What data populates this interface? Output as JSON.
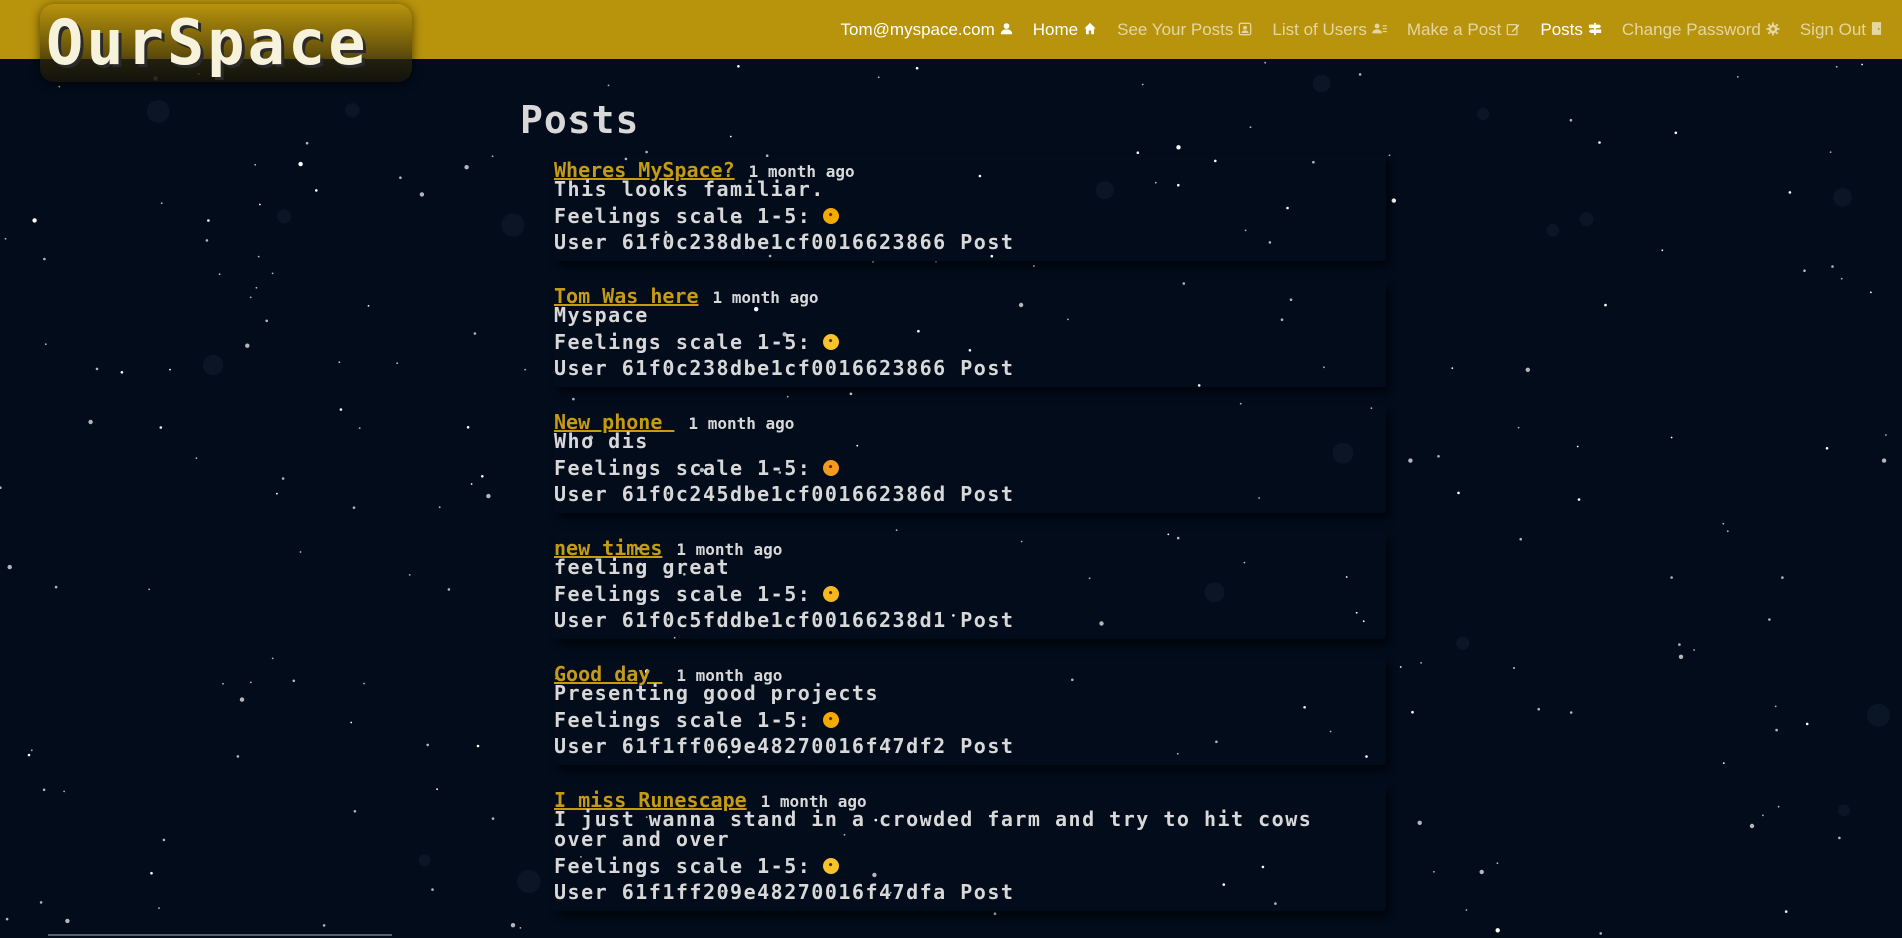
{
  "brand": {
    "name": "OurSpace"
  },
  "nav": {
    "user_email": "Tom@myspace.com",
    "items": [
      {
        "label": "Home",
        "icon": "home-icon",
        "active": true
      },
      {
        "label": "See Your Posts",
        "icon": "profile-card-icon",
        "active": false
      },
      {
        "label": "List of Users",
        "icon": "users-icon",
        "active": false
      },
      {
        "label": "Make a Post",
        "icon": "pencil-square-icon",
        "active": false
      },
      {
        "label": "Posts",
        "icon": "signpost-icon",
        "active": true
      },
      {
        "label": "Change Password",
        "icon": "gear-icon",
        "active": false
      },
      {
        "label": "Sign Out",
        "icon": "door-icon",
        "active": false
      }
    ]
  },
  "main": {
    "title": "Posts",
    "feelings_label": "Feelings scale 1-5:",
    "user_prefix": "User",
    "post_link_label": "Post",
    "posts": [
      {
        "title": "Wheres MySpace?",
        "time": "1 month ago",
        "body": "This looks familiar.",
        "emoji": "tongue-face-emoji",
        "user_id": "61f0c238dbe1cf0016623866"
      },
      {
        "title": "Tom Was here",
        "time": "1 month ago",
        "body": "Myspace",
        "emoji": "crying-face-emoji",
        "user_id": "61f0c238dbe1cf0016623866"
      },
      {
        "title": "New phone ",
        "time": "1 month ago",
        "body": "Who dis",
        "emoji": "angry-face-emoji",
        "user_id": "61f0c245dbe1cf001662386d"
      },
      {
        "title": "new times",
        "time": "1 month ago",
        "body": "feeling great",
        "emoji": "grinning-face-emoji",
        "user_id": "61f0c5fddbe1cf00166238d1"
      },
      {
        "title": "Good day ",
        "time": "1 month ago",
        "body": "Presenting good projects",
        "emoji": "tongue-face-emoji",
        "user_id": "61f1ff069e48270016f47df2"
      },
      {
        "title": "I miss Runescape",
        "time": "1 month ago",
        "body": "I just wanna stand in a crowded farm and try to hit cows over and over",
        "emoji": "crying-face-emoji",
        "user_id": "61f1ff209e48270016f47dfa"
      }
    ]
  },
  "colors": {
    "navbar": "#b8930c",
    "background": "#020c1b",
    "post_title": "#c59a15"
  }
}
